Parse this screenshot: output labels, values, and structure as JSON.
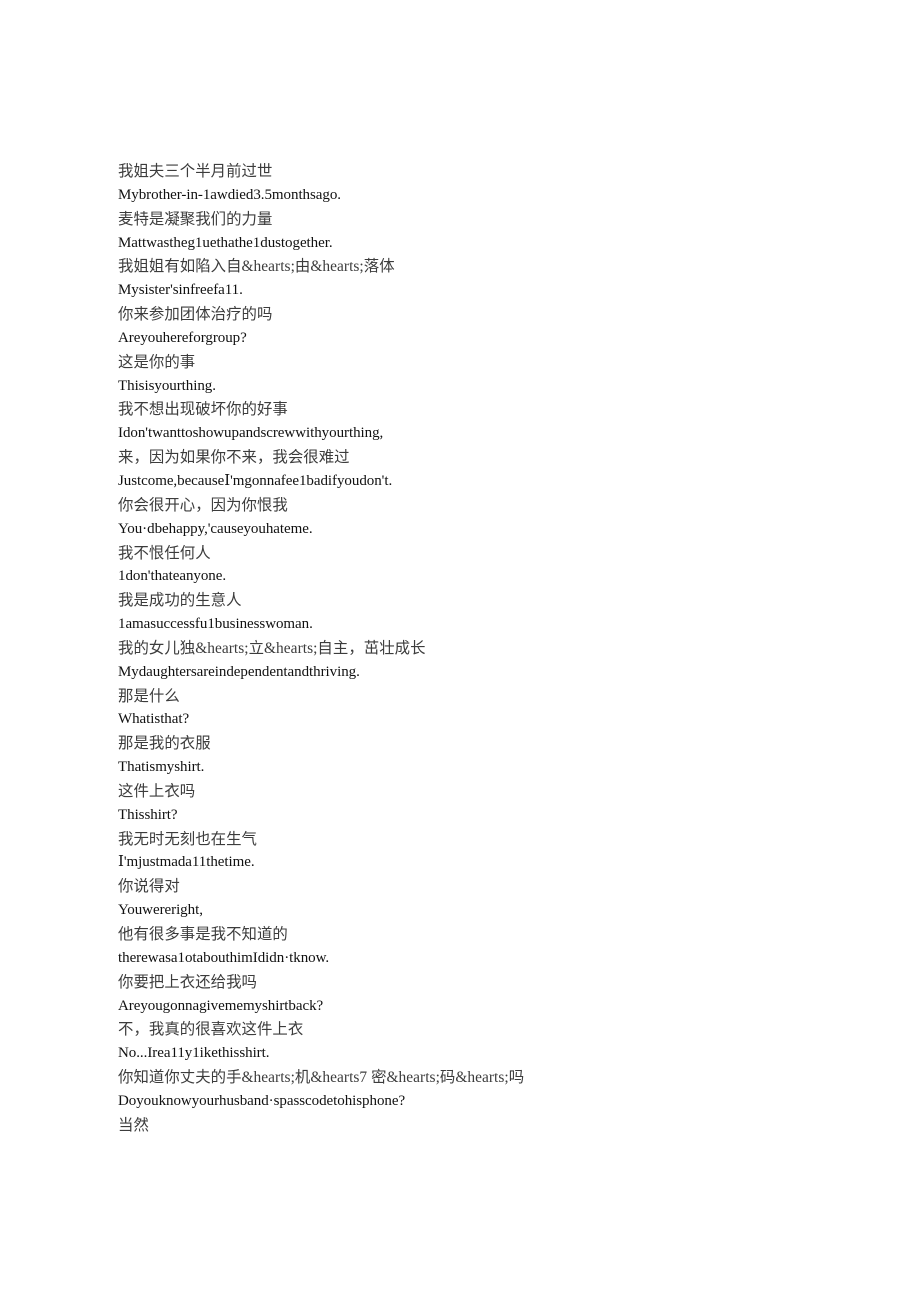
{
  "document": {
    "type": "bilingual-subtitle-transcript",
    "background_color": "#ffffff",
    "text_color_source": "#3c3c3c",
    "text_color_translation": "#111111",
    "lines": [
      {
        "lang": "zh",
        "text": "我姐夫三个半月前过世"
      },
      {
        "lang": "en",
        "text": "Mybrother-in-1awdied3.5monthsago."
      },
      {
        "lang": "zh",
        "text": "麦特是凝聚我们的力量"
      },
      {
        "lang": "en",
        "text": "Mattwastheg1uethathe1dustogether."
      },
      {
        "lang": "zh",
        "text": "我姐姐有如陷入自&hearts;由&hearts;落体"
      },
      {
        "lang": "en",
        "text": "Mysister'sinfreefa11."
      },
      {
        "lang": "zh",
        "text": "你来参加团体治疗的吗"
      },
      {
        "lang": "en",
        "text": "Areyouhereforgroup?"
      },
      {
        "lang": "zh",
        "text": "这是你的事"
      },
      {
        "lang": "en",
        "text": "Thisisyourthing."
      },
      {
        "lang": "zh",
        "text": "我不想出现破坏你的好事"
      },
      {
        "lang": "en",
        "text": "Idon'twanttoshowupandscrewwithyourthing,"
      },
      {
        "lang": "zh",
        "text": "来，因为如果你不来，我会很难过"
      },
      {
        "lang": "en",
        "text": "Justcome,becauseⅠ'mgonnafee1badifyoudon't."
      },
      {
        "lang": "zh",
        "text": "你会很开心，因为你恨我"
      },
      {
        "lang": "en",
        "text": "You·dbehappy,'causeyouhateme."
      },
      {
        "lang": "zh",
        "text": "我不恨任何人"
      },
      {
        "lang": "en",
        "text": "1don'thateanyone."
      },
      {
        "lang": "zh",
        "text": "我是成功的生意人"
      },
      {
        "lang": "en",
        "text": "1amasuccessfu1businesswoman."
      },
      {
        "lang": "zh",
        "text": "我的女儿独&hearts;立&hearts;自主，茁壮成长"
      },
      {
        "lang": "en",
        "text": "Mydaughtersareindependentandthriving."
      },
      {
        "lang": "zh",
        "text": "那是什么"
      },
      {
        "lang": "en",
        "text": "Whatisthat?"
      },
      {
        "lang": "zh",
        "text": "那是我的衣服"
      },
      {
        "lang": "en",
        "text": "Thatismyshirt."
      },
      {
        "lang": "zh",
        "text": "这件上衣吗"
      },
      {
        "lang": "en",
        "text": "Thisshirt?"
      },
      {
        "lang": "zh",
        "text": "我无时无刻也在生气"
      },
      {
        "lang": "en",
        "text": "Ⅰ'mjustmada11thetime."
      },
      {
        "lang": "zh",
        "text": "你说得对"
      },
      {
        "lang": "en",
        "text": "Youwereright,"
      },
      {
        "lang": "zh",
        "text": "他有很多事是我不知道的"
      },
      {
        "lang": "en",
        "text": "therewasa1otabouthimIdidn·tknow."
      },
      {
        "lang": "zh",
        "text": "你要把上衣还给我吗"
      },
      {
        "lang": "en",
        "text": "Areyougonnagivememyshirtback?"
      },
      {
        "lang": "zh",
        "text": "不，我真的很喜欢这件上衣"
      },
      {
        "lang": "en",
        "text": "No...Irea11y1ikethisshirt."
      },
      {
        "lang": "zh",
        "text": "你知道你丈夫的手&hearts;机&hearts7 密&hearts;码&hearts;吗"
      },
      {
        "lang": "en",
        "text": "Doyouknowyourhusband·spasscodetohisphone?"
      },
      {
        "lang": "zh",
        "text": "当然"
      }
    ]
  }
}
